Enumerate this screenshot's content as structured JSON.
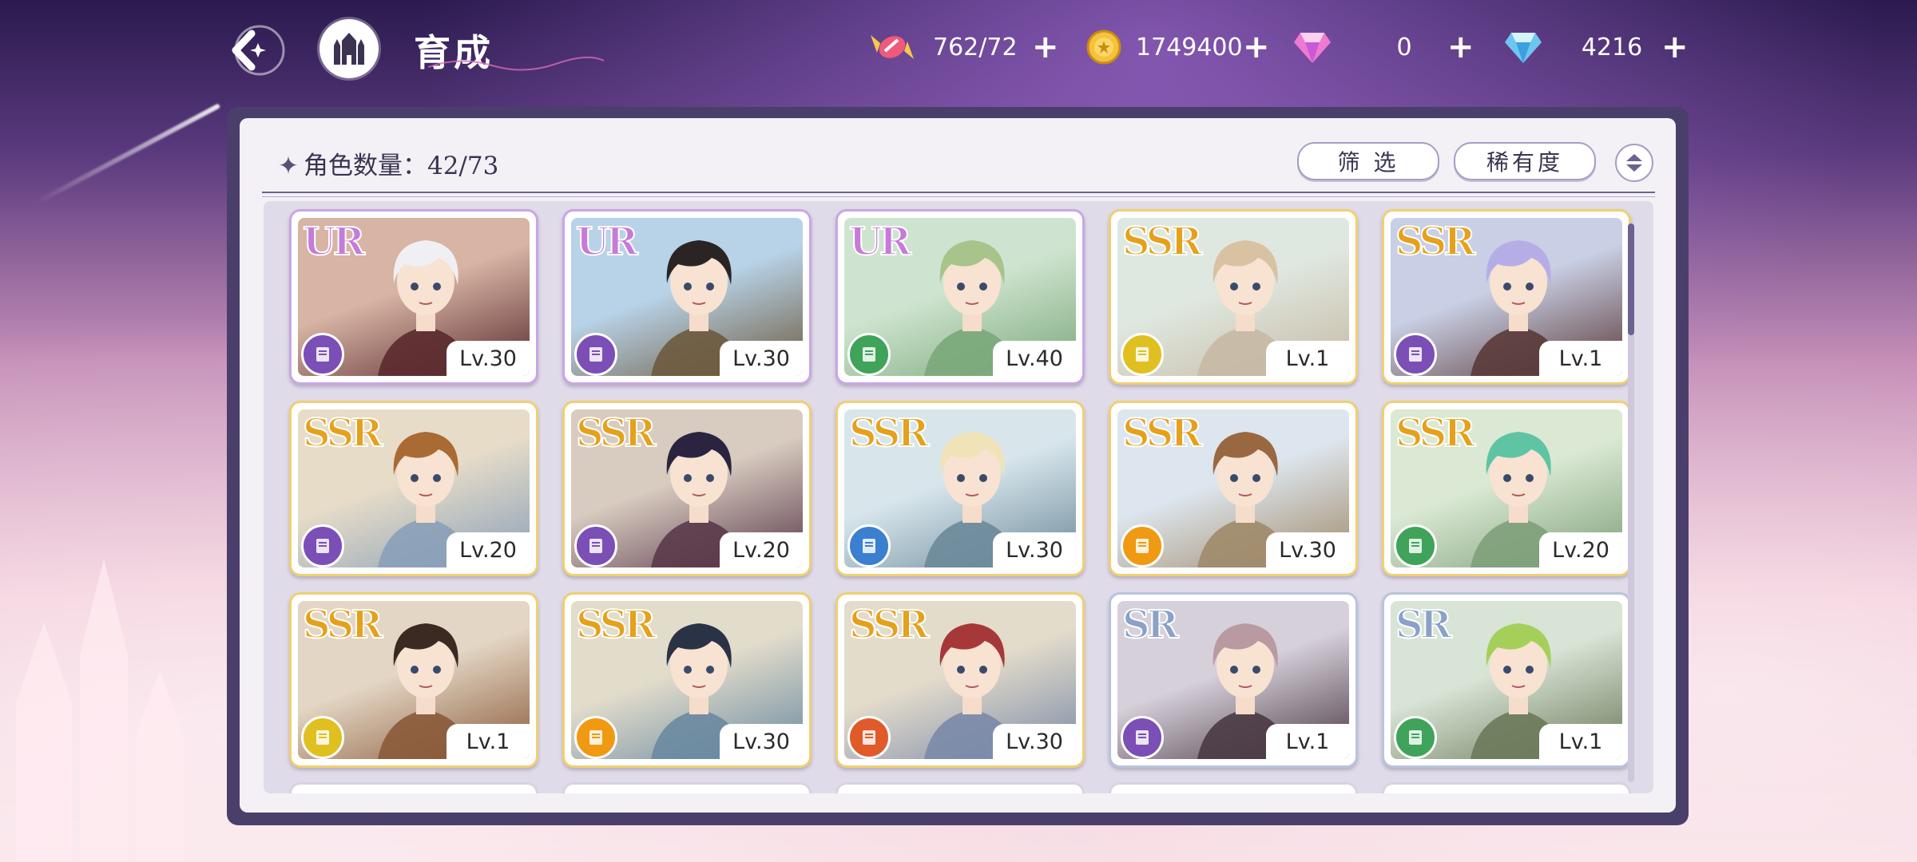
{
  "header": {
    "title": "育成",
    "resources": [
      {
        "icon": "candy-icon",
        "value": "762/72"
      },
      {
        "icon": "gold-coin-icon",
        "value": "1749400"
      },
      {
        "icon": "pink-gem-icon",
        "value": "0"
      },
      {
        "icon": "blue-diamond-icon",
        "value": "4216"
      }
    ]
  },
  "panel": {
    "count_label": "角色数量：42/73",
    "filter_label": "筛 选",
    "sort_label": "稀有度"
  },
  "colors": {
    "UR": "#c77ad8",
    "SSR": "#e5a11b",
    "SR": "#8aa1c8",
    "class_purple": "#7b4fb5",
    "class_green": "#3fa35a",
    "class_yellow": "#e0c020",
    "class_blue": "#3b7fd0",
    "class_orange": "#ef9a12",
    "class_red": "#e15a2a"
  },
  "cards": [
    {
      "rarity": "UR",
      "level": "Lv.30",
      "class": "class_purple",
      "bg": [
        "#d7b4a4",
        "#5a2a2e"
      ],
      "hair": "#f0f0f4"
    },
    {
      "rarity": "UR",
      "level": "Lv.30",
      "class": "class_purple",
      "bg": [
        "#b8d3e8",
        "#6d5a3e"
      ],
      "hair": "#2b2424"
    },
    {
      "rarity": "UR",
      "level": "Lv.40",
      "class": "class_green",
      "bg": [
        "#cfe4d0",
        "#7aa87a"
      ],
      "hair": "#a9c48a"
    },
    {
      "rarity": "SSR",
      "level": "Lv.1",
      "class": "class_yellow",
      "bg": [
        "#dfe8e0",
        "#c7b9a4"
      ],
      "hair": "#d9c2a2"
    },
    {
      "rarity": "SSR",
      "level": "Lv.1",
      "class": "class_purple",
      "bg": [
        "#c9cfe4",
        "#5a3a3a"
      ],
      "hair": "#b5aee6"
    },
    {
      "rarity": "SSR",
      "level": "Lv.20",
      "class": "class_purple",
      "bg": [
        "#e6dcc8",
        "#8aa0b8"
      ],
      "hair": "#a96a34"
    },
    {
      "rarity": "SSR",
      "level": "Lv.20",
      "class": "class_purple",
      "bg": [
        "#d8cbc0",
        "#5a3a4a"
      ],
      "hair": "#2a2440"
    },
    {
      "rarity": "SSR",
      "level": "Lv.30",
      "class": "class_blue",
      "bg": [
        "#d8e6ec",
        "#6c8a9a"
      ],
      "hair": "#f0e3b8"
    },
    {
      "rarity": "SSR",
      "level": "Lv.30",
      "class": "class_orange",
      "bg": [
        "#dde6ee",
        "#a08a6a"
      ],
      "hair": "#9a6840"
    },
    {
      "rarity": "SSR",
      "level": "Lv.20",
      "class": "class_green",
      "bg": [
        "#dbe9d4",
        "#7ea07a"
      ],
      "hair": "#5fc4a4"
    },
    {
      "rarity": "SSR",
      "level": "Lv.1",
      "class": "class_yellow",
      "bg": [
        "#e3d6c4",
        "#8a5a3a"
      ],
      "hair": "#3a2a22"
    },
    {
      "rarity": "SSR",
      "level": "Lv.30",
      "class": "class_orange",
      "bg": [
        "#e2dccb",
        "#6a8aa0"
      ],
      "hair": "#2a3246"
    },
    {
      "rarity": "SSR",
      "level": "Lv.30",
      "class": "class_red",
      "bg": [
        "#e4dccb",
        "#7a8aa8"
      ],
      "hair": "#a6383a"
    },
    {
      "rarity": "SR",
      "level": "Lv.1",
      "class": "class_purple",
      "bg": [
        "#d6d0da",
        "#4a3a44"
      ],
      "hair": "#b89aa0"
    },
    {
      "rarity": "SR",
      "level": "Lv.1",
      "class": "class_green",
      "bg": [
        "#d8e4d6",
        "#6a7a5a"
      ],
      "hair": "#a4d05a"
    }
  ]
}
